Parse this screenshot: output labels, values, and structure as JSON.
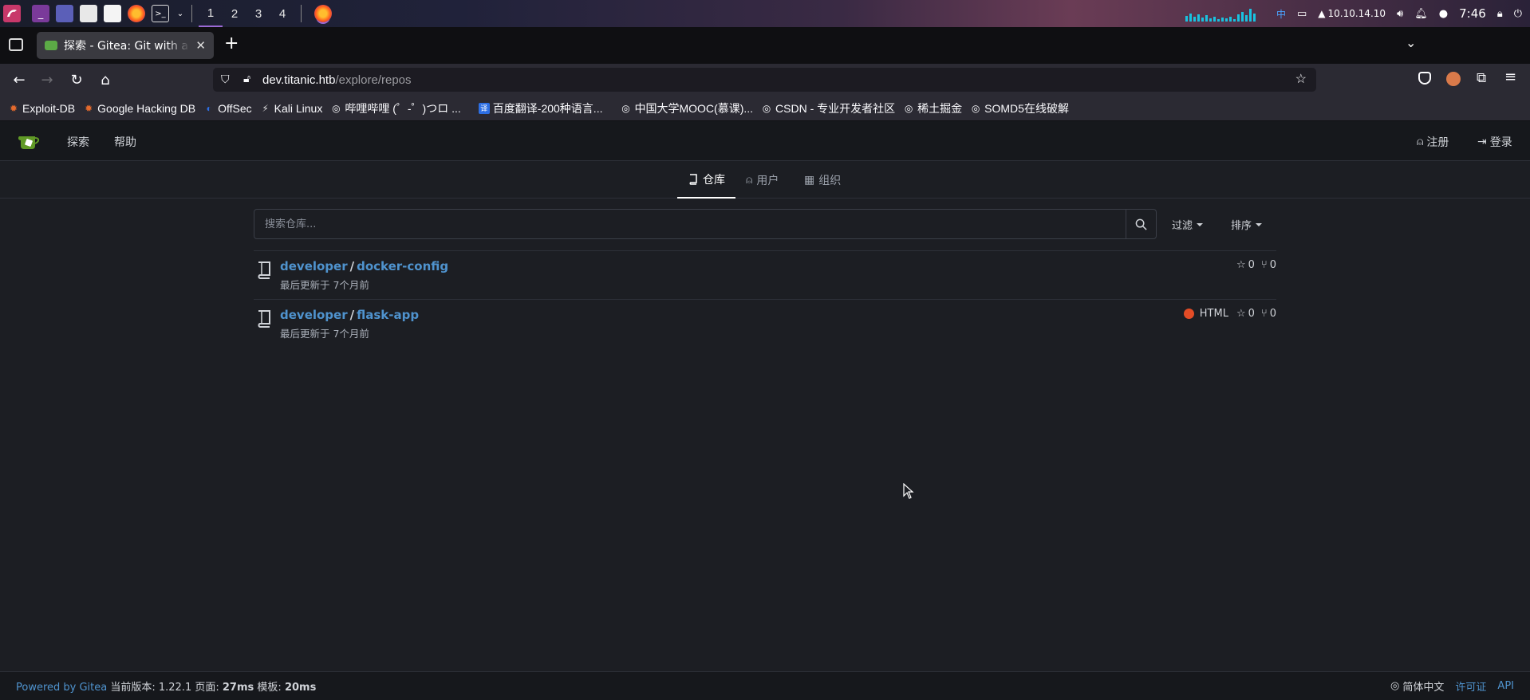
{
  "taskbar": {
    "workspaces": [
      "1",
      "2",
      "3",
      "4"
    ],
    "ime": "中",
    "ip": "10.10.14.10",
    "time": "7:46"
  },
  "browser": {
    "tab_title": "探索 - Gitea: Git with a cup of tea",
    "url_host": "dev.titanic.htb",
    "url_path": "/explore/repos",
    "bookmarks": [
      {
        "label": "Exploit-DB",
        "icon": "exploit-icon"
      },
      {
        "label": "Google Hacking DB",
        "icon": "exploit-icon"
      },
      {
        "label": "OffSec",
        "icon": "offsec-icon"
      },
      {
        "label": "Kali Linux",
        "icon": "kali-icon"
      },
      {
        "label": "哔哩哔哩 (゜-゜)つロ ...",
        "icon": "globe-icon"
      },
      {
        "label": "百度翻译-200种语言...",
        "icon": "translate-icon"
      },
      {
        "label": "中国大学MOOC(慕课)...",
        "icon": "globe-icon"
      },
      {
        "label": "CSDN - 专业开发者社区",
        "icon": "globe-icon"
      },
      {
        "label": "稀土掘金",
        "icon": "globe-icon"
      },
      {
        "label": "SOMD5在线破解",
        "icon": "globe-icon"
      }
    ]
  },
  "gitea": {
    "nav": {
      "explore": "探索",
      "help": "帮助",
      "register": "注册",
      "login": "登录"
    },
    "subnav": {
      "repos": "仓库",
      "users": "用户",
      "orgs": "组织"
    },
    "search": {
      "placeholder": "搜索仓库..."
    },
    "filter_label": "过滤",
    "sort_label": "排序",
    "repos": [
      {
        "owner": "developer",
        "name": "docker-config",
        "updated": "最后更新于 7个月前",
        "language": "",
        "language_color": "",
        "stars": "0",
        "forks": "0"
      },
      {
        "owner": "developer",
        "name": "flask-app",
        "updated": "最后更新于 7个月前",
        "language": "HTML",
        "language_color": "#e34c26",
        "stars": "0",
        "forks": "0"
      }
    ],
    "footer": {
      "powered": "Powered by Gitea",
      "version_label": "当前版本: 1.22.1 页面:",
      "page_time": "27ms",
      "tmpl_label": "模板:",
      "tmpl_time": "20ms",
      "language": "简体中文",
      "license": "许可证",
      "api": "API"
    }
  }
}
